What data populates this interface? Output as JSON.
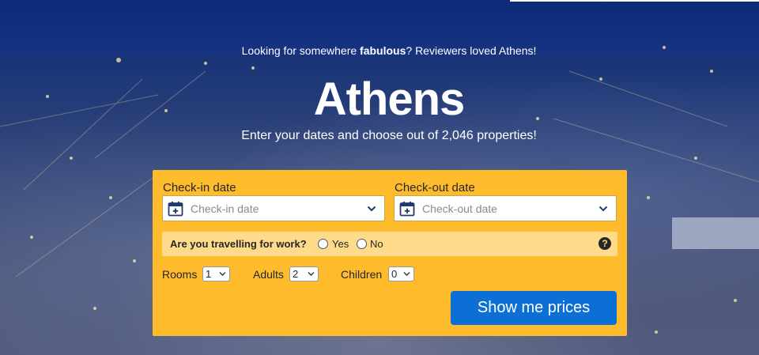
{
  "hero": {
    "tagline_pre": "Looking for somewhere ",
    "tagline_bold": "fabulous",
    "tagline_post": "? Reviewers loved Athens!",
    "city": "Athens",
    "subtitle": "Enter your dates and choose out of 2,046 properties!"
  },
  "search": {
    "checkin_label": "Check-in date",
    "checkin_placeholder": "Check-in date",
    "checkout_label": "Check-out date",
    "checkout_placeholder": "Check-out date",
    "work_question": "Are you travelling for work?",
    "work_yes": "Yes",
    "work_no": "No",
    "help_icon_text": "?",
    "rooms_label": "Rooms",
    "rooms_value": "1",
    "adults_label": "Adults",
    "adults_value": "2",
    "children_label": "Children",
    "children_value": "0",
    "submit_label": "Show me prices"
  },
  "icons": {
    "calendar": "calendar-icon",
    "chevron": "chevron-down-icon",
    "help": "help-icon"
  },
  "colors": {
    "search_box": "#febb2c",
    "work_row": "#fedb8a",
    "button": "#0c6fd6",
    "hero_bg": "#1c2f5e"
  }
}
